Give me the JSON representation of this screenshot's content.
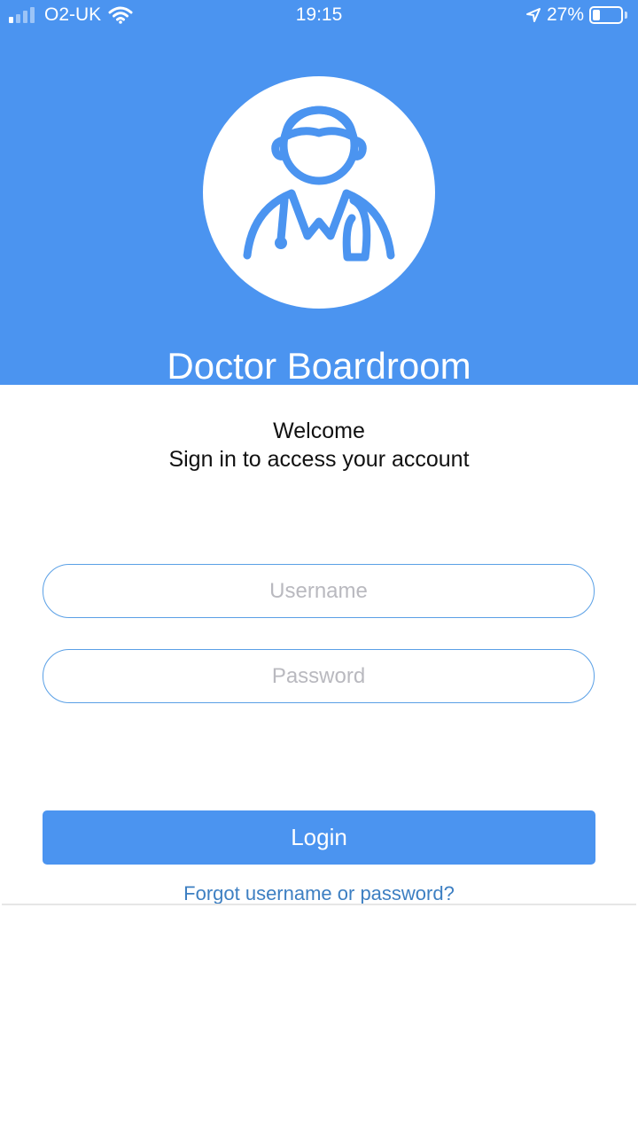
{
  "status_bar": {
    "carrier": "O2-UK",
    "time": "19:15",
    "battery": "27%",
    "battery_level": 0.27
  },
  "colors": {
    "brand_blue": "#4b94f0",
    "link_blue": "#3d7fc2"
  },
  "header": {
    "avatar_icon": "doctor-icon",
    "app_title": "Doctor Boardroom"
  },
  "welcome": {
    "line1": "Welcome",
    "line2": "Sign in to access your account"
  },
  "form": {
    "username_placeholder": "Username",
    "username_value": "",
    "password_placeholder": "Password",
    "password_value": "",
    "login_label": "Login",
    "forgot_label": "Forgot username or password?"
  }
}
